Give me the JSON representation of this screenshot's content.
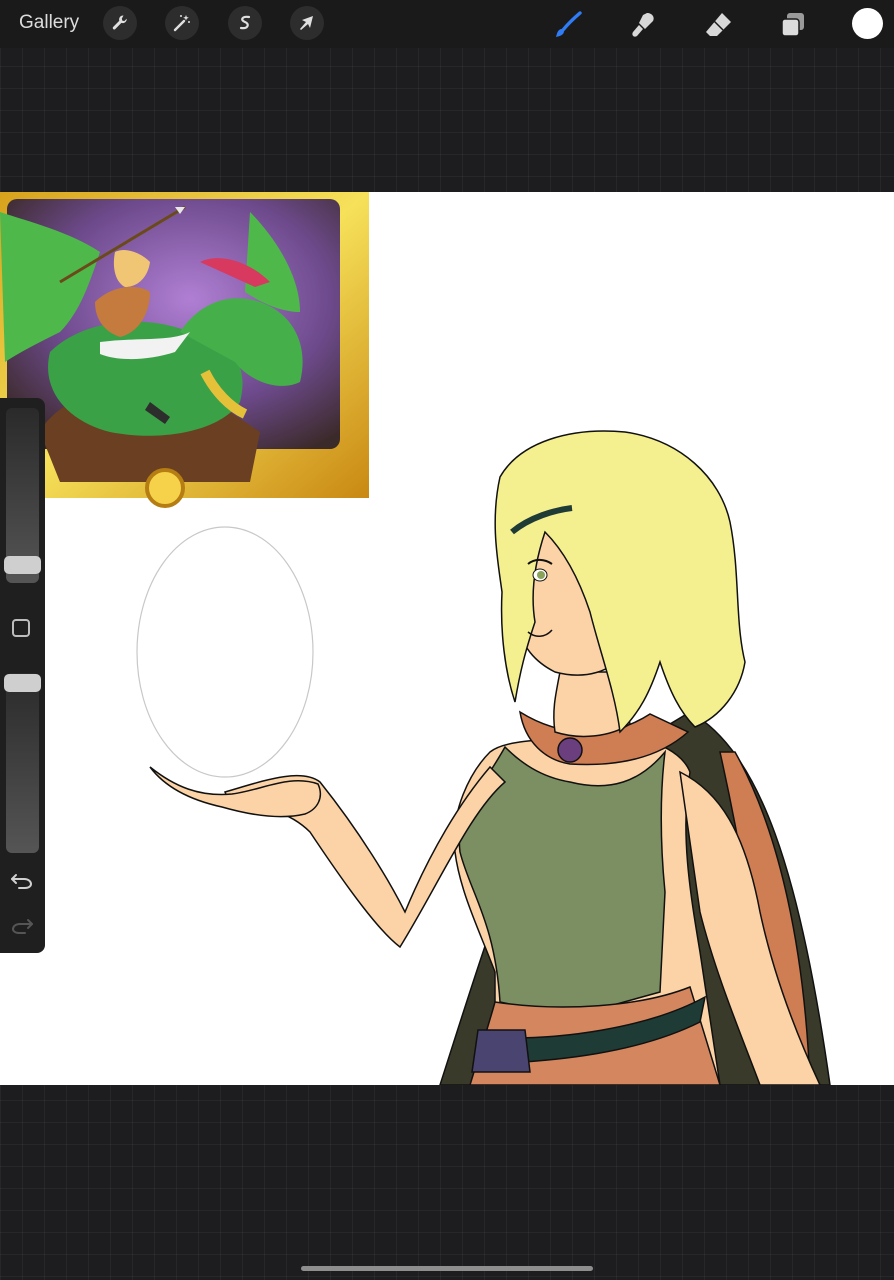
{
  "toolbar": {
    "gallery_label": "Gallery",
    "left_tools": [
      {
        "name": "actions",
        "icon": "wrench-icon"
      },
      {
        "name": "adjustments",
        "icon": "magic-wand-icon"
      },
      {
        "name": "selection",
        "icon": "selection-s-icon"
      },
      {
        "name": "transform",
        "icon": "arrow-cursor-icon"
      }
    ],
    "right_tools": [
      {
        "name": "brush",
        "icon": "brush-icon",
        "active": true
      },
      {
        "name": "smudge",
        "icon": "smudge-icon",
        "active": false
      },
      {
        "name": "eraser",
        "icon": "eraser-icon",
        "active": false
      },
      {
        "name": "layers",
        "icon": "layers-icon",
        "active": false
      }
    ],
    "current_color": "#ffffff"
  },
  "sidebar": {
    "brush_size_level": 0.16,
    "opacity_level": 0.95,
    "modify_icon": "square-icon",
    "undo_icon": "undo-icon",
    "redo_icon": "redo-icon"
  },
  "colors": {
    "accent": "#2f7cf6",
    "hair": "#f5f08f",
    "skin": "#fcd3a6",
    "top": "#7b8f63",
    "cape": "#d4875e",
    "belt": "#1f3b35"
  }
}
